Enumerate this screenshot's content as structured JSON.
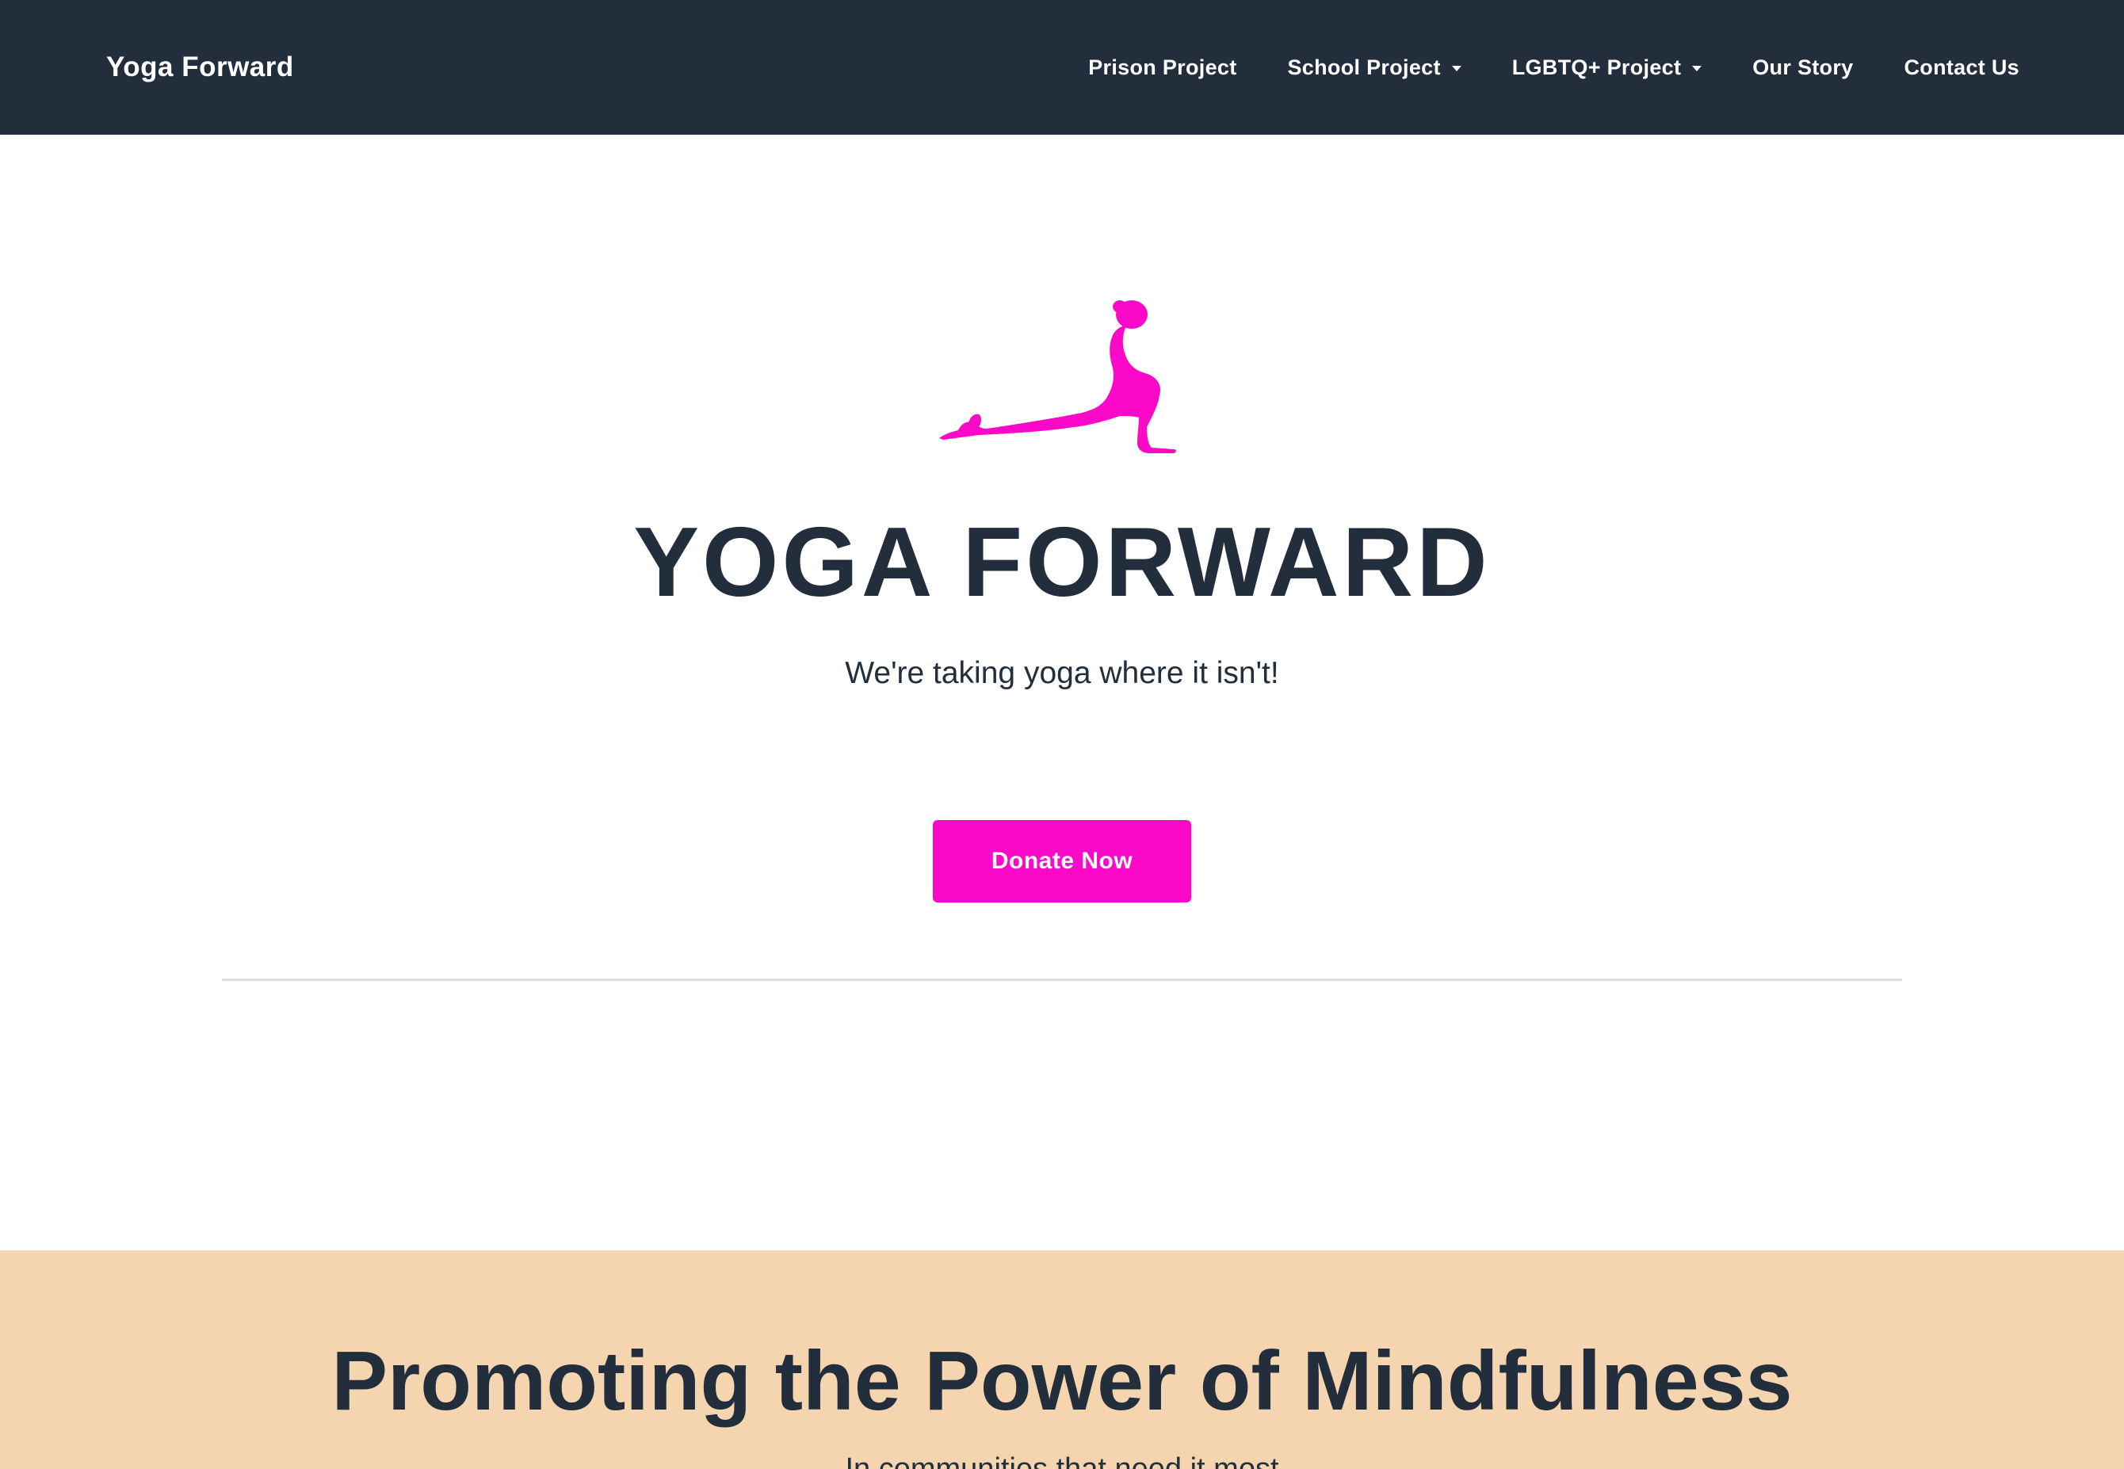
{
  "navbar": {
    "brand": "Yoga Forward",
    "items": [
      {
        "label": "Prison Project",
        "dropdown": false
      },
      {
        "label": "School Project",
        "dropdown": true
      },
      {
        "label": "LGBTQ+ Project",
        "dropdown": true
      },
      {
        "label": "Our Story",
        "dropdown": false
      },
      {
        "label": "Contact Us",
        "dropdown": false
      }
    ]
  },
  "hero": {
    "logo_icon": "yoga-cobra-pose-icon",
    "title": "YOGA FORWARD",
    "subtitle": "We're taking yoga where it isn't!",
    "donate_label": "Donate Now"
  },
  "mindfulness": {
    "title": "Promoting the Power of Mindfulness",
    "subtitle": "In communities that need it most"
  },
  "colors": {
    "navbar_bg": "#232e3d",
    "accent_pink": "#fc08c8",
    "section_peach": "#f5d5b0",
    "text_dark": "#232e3d"
  }
}
